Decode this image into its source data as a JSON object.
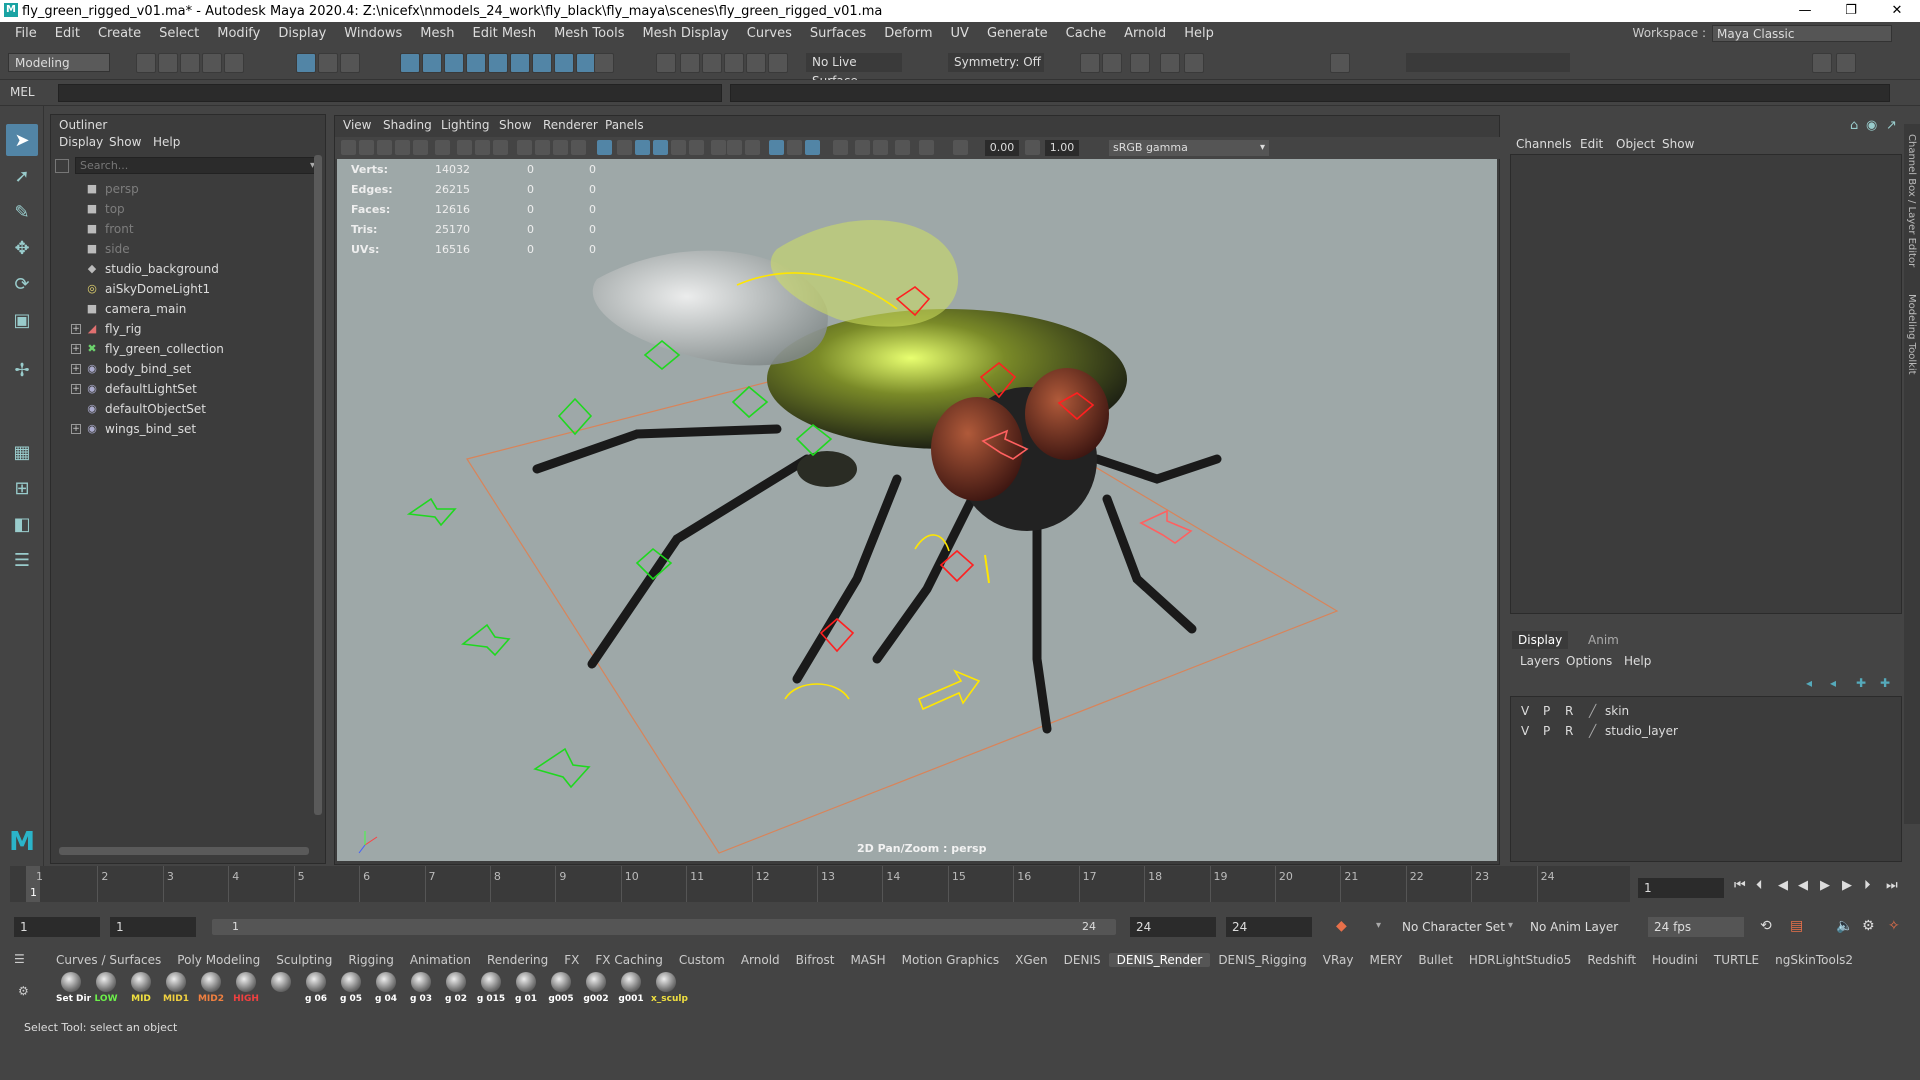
{
  "titlebar": {
    "title": "fly_green_rigged_v01.ma* - Autodesk Maya 2020.4: Z:\\nicefx\\nmodels_24_work\\fly_black\\fly_maya\\scenes\\fly_green_rigged_v01.ma",
    "logo": "M"
  },
  "menus": [
    "File",
    "Edit",
    "Create",
    "Select",
    "Modify",
    "Display",
    "Windows",
    "Mesh",
    "Edit Mesh",
    "Mesh Tools",
    "Mesh Display",
    "Curves",
    "Surfaces",
    "Deform",
    "UV",
    "Generate",
    "Cache",
    "Arnold",
    "Help"
  ],
  "workspace": {
    "label": "Workspace :",
    "value": "Maya Classic"
  },
  "statusline": {
    "mode": "Modeling",
    "live_surface": "No Live Surface",
    "symmetry": "Symmetry: Off"
  },
  "cmdline": {
    "label": "MEL"
  },
  "outliner": {
    "title": "Outliner",
    "menus": [
      "Display",
      "Show",
      "Help"
    ],
    "search_placeholder": "Search...",
    "items": [
      {
        "label": "persp",
        "icon": "camera-icon",
        "dim": true,
        "expand": false
      },
      {
        "label": "top",
        "icon": "camera-icon",
        "dim": true,
        "expand": false
      },
      {
        "label": "front",
        "icon": "camera-icon",
        "dim": true,
        "expand": false
      },
      {
        "label": "side",
        "icon": "camera-icon",
        "dim": true,
        "expand": false
      },
      {
        "label": "studio_background",
        "icon": "mesh-icon",
        "dim": false,
        "expand": false
      },
      {
        "label": "aiSkyDomeLight1",
        "icon": "light-icon",
        "dim": false,
        "expand": false
      },
      {
        "label": "camera_main",
        "icon": "camera-icon",
        "dim": false,
        "expand": false
      },
      {
        "label": "fly_rig",
        "icon": "rig-icon",
        "dim": false,
        "expand": true
      },
      {
        "label": "fly_green_collection",
        "icon": "collection-icon",
        "dim": false,
        "expand": true
      },
      {
        "label": "body_bind_set",
        "icon": "set-icon",
        "dim": false,
        "expand": true
      },
      {
        "label": "defaultLightSet",
        "icon": "set-icon",
        "dim": false,
        "expand": true
      },
      {
        "label": "defaultObjectSet",
        "icon": "set-icon",
        "dim": false,
        "expand": false
      },
      {
        "label": "wings_bind_set",
        "icon": "set-icon",
        "dim": false,
        "expand": true
      }
    ]
  },
  "viewport": {
    "menus": [
      "View",
      "Shading",
      "Lighting",
      "Show",
      "Renderer",
      "Panels"
    ],
    "near": "0.00",
    "far": "1.00",
    "colorspace": "sRGB gamma",
    "hud": [
      {
        "label": "Verts:",
        "a": "14032",
        "b": "0",
        "c": "0"
      },
      {
        "label": "Edges:",
        "a": "26215",
        "b": "0",
        "c": "0"
      },
      {
        "label": "Faces:",
        "a": "12616",
        "b": "0",
        "c": "0"
      },
      {
        "label": "Tris:",
        "a": "25170",
        "b": "0",
        "c": "0"
      },
      {
        "label": "UVs:",
        "a": "16516",
        "b": "0",
        "c": "0"
      }
    ],
    "caption": "2D Pan/Zoom : persp"
  },
  "channelbox": {
    "menus": [
      "Channels",
      "Edit",
      "Object",
      "Show"
    ],
    "side_tabs": [
      "Channel Box / Layer Editor",
      "Modeling Toolkit"
    ],
    "tabs": [
      "Display",
      "Anim"
    ],
    "layer_menus": [
      "Layers",
      "Options",
      "Help"
    ],
    "layers": [
      {
        "v": "V",
        "p": "P",
        "r": "R",
        "name": "skin"
      },
      {
        "v": "V",
        "p": "P",
        "r": "R",
        "name": "studio_layer"
      }
    ]
  },
  "timeline": {
    "ticks": [
      "1",
      "2",
      "3",
      "4",
      "5",
      "6",
      "7",
      "8",
      "9",
      "10",
      "11",
      "12",
      "13",
      "14",
      "15",
      "16",
      "17",
      "18",
      "19",
      "20",
      "21",
      "22",
      "23",
      "24"
    ],
    "current": "1",
    "current_field": "1"
  },
  "range": {
    "start": "1",
    "anim_start": "1",
    "slider_left": "1",
    "slider_right": "24",
    "end": "24",
    "anim_end": "24",
    "character_set": "No Character Set",
    "anim_layer": "No Anim Layer",
    "fps": "24 fps"
  },
  "shelf_tabs": [
    "Curves / Surfaces",
    "Poly Modeling",
    "Sculpting",
    "Rigging",
    "Animation",
    "Rendering",
    "FX",
    "FX Caching",
    "Custom",
    "Arnold",
    "Bifrost",
    "MASH",
    "Motion Graphics",
    "XGen",
    "DENIS",
    "DENIS_Render",
    "DENIS_Rigging",
    "VRay",
    "MERY",
    "Bullet",
    "HDRLightStudio5",
    "Redshift",
    "Houdini",
    "TURTLE",
    "ngSkinTools2"
  ],
  "active_shelf": "DENIS_Render",
  "shelf_buttons": [
    {
      "label": "Set Dir",
      "color": "#ffffff"
    },
    {
      "label": "LOW",
      "color": "#6cf04a"
    },
    {
      "label": "MID",
      "color": "#f0e040"
    },
    {
      "label": "MID1",
      "color": "#f0d040"
    },
    {
      "label": "MID2",
      "color": "#f08040"
    },
    {
      "label": "HIGH",
      "color": "#f04040"
    },
    {
      "label": "",
      "color": "#ffffff"
    },
    {
      "label": "g 06",
      "color": "#ffffff"
    },
    {
      "label": "g 05",
      "color": "#ffffff"
    },
    {
      "label": "g 04",
      "color": "#ffffff"
    },
    {
      "label": "g 03",
      "color": "#ffffff"
    },
    {
      "label": "g 02",
      "color": "#ffffff"
    },
    {
      "label": "g 015",
      "color": "#ffffff"
    },
    {
      "label": "g 01",
      "color": "#ffffff"
    },
    {
      "label": "g005",
      "color": "#ffffff"
    },
    {
      "label": "g002",
      "color": "#ffffff"
    },
    {
      "label": "g001",
      "color": "#ffffff"
    },
    {
      "label": "x_sculp",
      "color": "#f0e040"
    }
  ],
  "helpline": "Select Tool: select an object"
}
